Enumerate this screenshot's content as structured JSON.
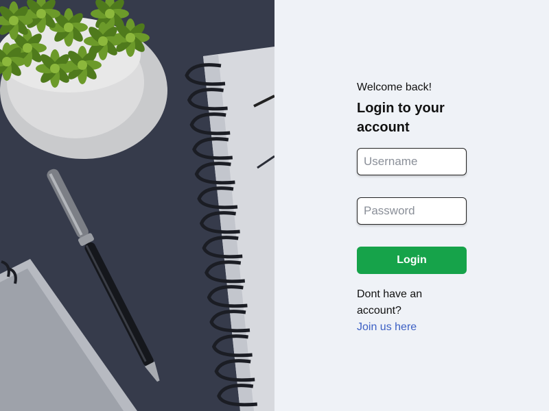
{
  "login": {
    "greeting": "Welcome back!",
    "heading": "Login to your account",
    "username_placeholder": "Username",
    "password_placeholder": "Password",
    "button_label": "Login",
    "signup_prompt": "Dont have an account?",
    "signup_link": "Join us here"
  },
  "hero": {
    "image_description_icon": "desk-photo-image",
    "colors": {
      "overlay": "#3a3f4f",
      "accent_green": "#16a34a",
      "link_blue": "#3b5fc4",
      "panel_bg": "#eff2f7"
    }
  }
}
